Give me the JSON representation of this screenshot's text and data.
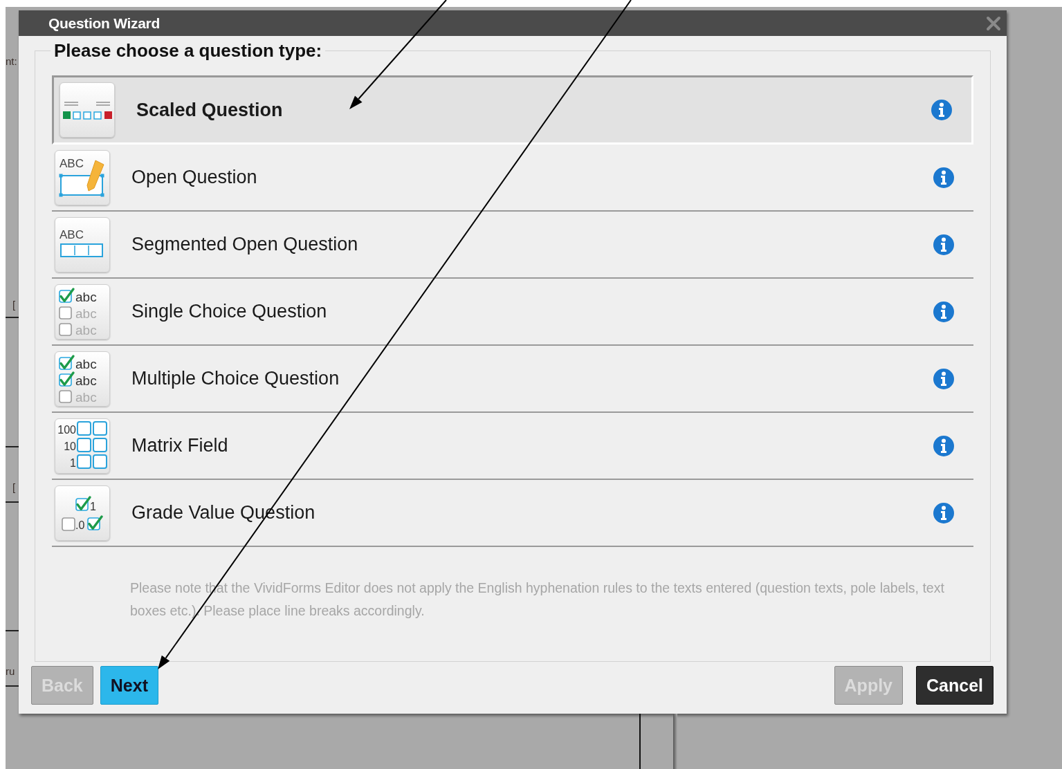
{
  "background_fragments": [
    "nt:",
    "[",
    "[",
    "ru"
  ],
  "window": {
    "title": "Question Wizard"
  },
  "legend": "Please choose a question type:",
  "question_types": [
    {
      "label": "Scaled Question",
      "selected": true,
      "icon": {
        "kind": "scaled"
      }
    },
    {
      "label": "Open Question",
      "selected": false,
      "icon": {
        "kind": "open",
        "text": "ABC"
      }
    },
    {
      "label": "Segmented Open Question",
      "selected": false,
      "icon": {
        "kind": "segmented",
        "text": "ABC"
      }
    },
    {
      "label": "Single Choice Question",
      "selected": false,
      "icon": {
        "kind": "choice",
        "options": [
          {
            "text": "abc",
            "checked": true
          },
          {
            "text": "abc",
            "checked": false
          },
          {
            "text": "abc",
            "checked": false
          }
        ]
      }
    },
    {
      "label": "Multiple Choice Question",
      "selected": false,
      "icon": {
        "kind": "choice",
        "options": [
          {
            "text": "abc",
            "checked": true
          },
          {
            "text": "abc",
            "checked": true
          },
          {
            "text": "abc",
            "checked": false
          }
        ]
      }
    },
    {
      "label": "Matrix Field",
      "selected": false,
      "icon": {
        "kind": "matrix",
        "rows": [
          "100",
          "10",
          "1"
        ]
      }
    },
    {
      "label": "Grade Value Question",
      "selected": false,
      "icon": {
        "kind": "grade",
        "texts": [
          "1",
          ".0"
        ]
      }
    }
  ],
  "note": "Please note that the VividForms Editor does not apply the English hyphenation rules to the texts entered (question texts, pole labels, text boxes etc.). Please place line breaks accordingly.",
  "buttons_left": [
    {
      "label": "Back",
      "kind": "default",
      "disabled": true
    },
    {
      "label": "Next",
      "kind": "primary",
      "disabled": false
    }
  ],
  "buttons_right": [
    {
      "label": "Apply",
      "kind": "default",
      "disabled": true
    },
    {
      "label": "Cancel",
      "kind": "dark",
      "disabled": false
    }
  ]
}
